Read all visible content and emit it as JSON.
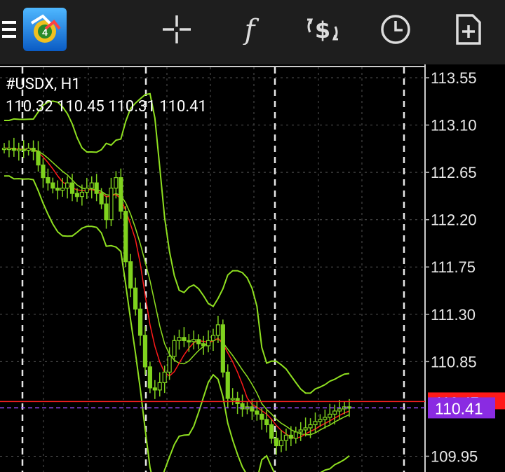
{
  "toolbar": {
    "icons": [
      "menu-icon",
      "metatrader-logo",
      "crosshair-icon",
      "indicators-icon",
      "trade-icon",
      "timeframe-icon",
      "new-order-icon"
    ]
  },
  "symbol_header": "#USDX, H1",
  "ohlc_line": "110.32 110.45 110.31 110.41",
  "price_scale": [
    "113.55",
    "113.10",
    "112.65",
    "112.20",
    "111.75",
    "111.30",
    "110.85",
    "109.95"
  ],
  "current_price": {
    "label": "110.41",
    "color": "#8a2be2"
  },
  "red_line_label": "110.47",
  "colors": {
    "bg": "#000000",
    "grid": "#555555",
    "candle": "#7fd21e",
    "bollinger": "#8fe020",
    "ma": "#ff1a1a",
    "ask_line": "#ff2020"
  },
  "chart_data": {
    "type": "candlestick",
    "symbol": "#USDX",
    "timeframe": "H1",
    "ylim": [
      109.8,
      113.65
    ],
    "y_ticks": [
      113.55,
      113.1,
      112.65,
      112.2,
      111.75,
      111.3,
      110.85,
      109.95
    ],
    "close_series": [
      112.88,
      112.88,
      112.86,
      112.87,
      112.86,
      112.88,
      112.85,
      112.72,
      112.6,
      112.55,
      112.5,
      112.48,
      112.5,
      112.55,
      112.45,
      112.42,
      112.46,
      112.5,
      112.55,
      112.45,
      112.35,
      112.2,
      112.5,
      112.6,
      112.28,
      111.8,
      111.55,
      111.35,
      111.1,
      110.8,
      110.6,
      110.58,
      110.65,
      110.75,
      110.9,
      111.05,
      111.08,
      111.05,
      111.04,
      111.06,
      111.02,
      111.0,
      111.05,
      111.1,
      111.2,
      110.75,
      110.5,
      110.5,
      110.45,
      110.4,
      110.42,
      110.38,
      110.35,
      110.3,
      110.25,
      110.12,
      110.05,
      110.1,
      110.15,
      110.12,
      110.18,
      110.2,
      110.22,
      110.25,
      110.28,
      110.3,
      110.32,
      110.35,
      110.38,
      110.4,
      110.42,
      110.41
    ],
    "ma_visible": true,
    "bollinger_visible": true,
    "grid": true
  }
}
